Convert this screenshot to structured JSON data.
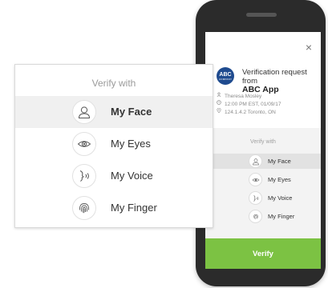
{
  "popup": {
    "title": "Verify with",
    "options": [
      {
        "label": "My Face",
        "icon": "face-icon",
        "selected": true
      },
      {
        "label": "My Eyes",
        "icon": "eye-icon",
        "selected": false
      },
      {
        "label": "My Voice",
        "icon": "voice-icon",
        "selected": false
      },
      {
        "label": "My Finger",
        "icon": "fingerprint-icon",
        "selected": false
      }
    ]
  },
  "phone": {
    "close_glyph": "×",
    "logo_text": "ABC",
    "logo_subtext": "COMPANY",
    "request_line": "Verification request from",
    "app_name": "ABC App",
    "user_name": "Theresa Mosley",
    "timestamp": "12:00 PM EST, 01/09/17",
    "location": "124.1.4.2 Toronto, ON",
    "verify_with": "Verify with",
    "options": [
      {
        "label": "My Face",
        "selected": true
      },
      {
        "label": "My Eyes",
        "selected": false
      },
      {
        "label": "My Voice",
        "selected": false
      },
      {
        "label": "My Finger",
        "selected": false
      }
    ],
    "verify_button": "Verify"
  },
  "colors": {
    "verify_green": "#7cc243",
    "logo_blue": "#1f4b8f",
    "phone_body": "#2b2b2b"
  }
}
